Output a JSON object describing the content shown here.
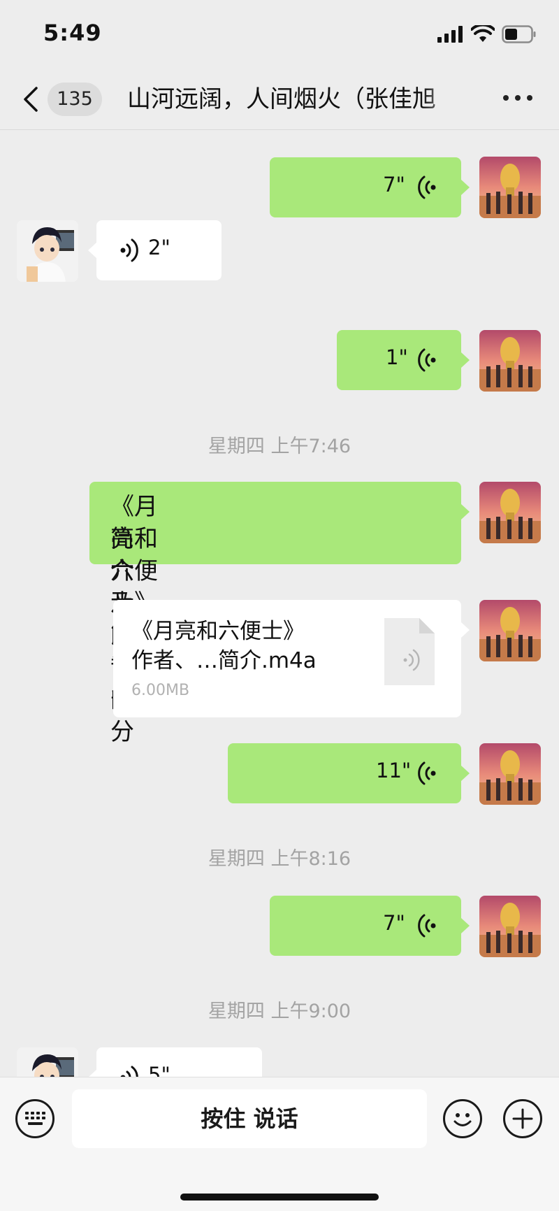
{
  "status_bar": {
    "time": "5:49"
  },
  "nav": {
    "unread_count": "135",
    "title": "山河远阔，人间烟火（张佳旭"
  },
  "messages": [
    {
      "type": "voice",
      "side": "right",
      "duration": "7\""
    },
    {
      "type": "voice",
      "side": "left",
      "duration": "2\""
    },
    {
      "type": "voice",
      "side": "right",
      "duration": "1\""
    },
    {
      "type": "timestamp",
      "text": "星期四 上午7:46"
    },
    {
      "type": "text",
      "side": "right",
      "lines": [
        "《月亮和六便士》朗读语音的",
        "简介及前言部分"
      ]
    },
    {
      "type": "file",
      "side": "right",
      "name_lines": [
        "《月亮和六便士》",
        "作者、…简介.m4a"
      ],
      "size": "6.00MB",
      "icon": "audio-file-icon"
    },
    {
      "type": "voice",
      "side": "right",
      "duration": "11\""
    },
    {
      "type": "timestamp",
      "text": "星期四 上午8:16"
    },
    {
      "type": "voice",
      "side": "right",
      "duration": "7\""
    },
    {
      "type": "timestamp",
      "text": "星期四 上午9:00"
    },
    {
      "type": "voice",
      "side": "left",
      "duration": "5\""
    }
  ],
  "input_bar": {
    "hold_to_talk_label": "按住 说话",
    "keyboard_icon": "keyboard-icon",
    "emoji_icon": "emoji-icon",
    "plus_icon": "plus-icon"
  },
  "colors": {
    "background": "#ededed",
    "sent_bubble": "#a9e87a",
    "received_bubble": "#ffffff",
    "timestamp_text": "#a3a3a3"
  }
}
